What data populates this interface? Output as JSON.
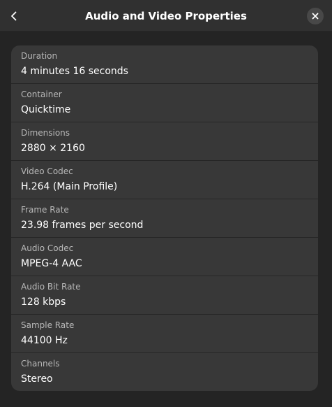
{
  "window": {
    "title": "Audio and Video Properties"
  },
  "icons": {
    "back": "chevron-left-icon",
    "close": "close-icon"
  },
  "properties": [
    {
      "label": "Duration",
      "value": "4 minutes 16 seconds"
    },
    {
      "label": "Container",
      "value": "Quicktime"
    },
    {
      "label": "Dimensions",
      "value": "2880 × 2160"
    },
    {
      "label": "Video Codec",
      "value": "H.264 (Main Profile)"
    },
    {
      "label": "Frame Rate",
      "value": "23.98 frames per second"
    },
    {
      "label": "Audio Codec",
      "value": "MPEG-4 AAC"
    },
    {
      "label": "Audio Bit Rate",
      "value": "128 kbps"
    },
    {
      "label": "Sample Rate",
      "value": "44100 Hz"
    },
    {
      "label": "Channels",
      "value": "Stereo"
    }
  ],
  "colors": {
    "headerbar": "#303030",
    "window_bg": "#242424",
    "card_bg": "#383838",
    "label_text": "#b8b8b8",
    "value_text": "#ffffff"
  }
}
